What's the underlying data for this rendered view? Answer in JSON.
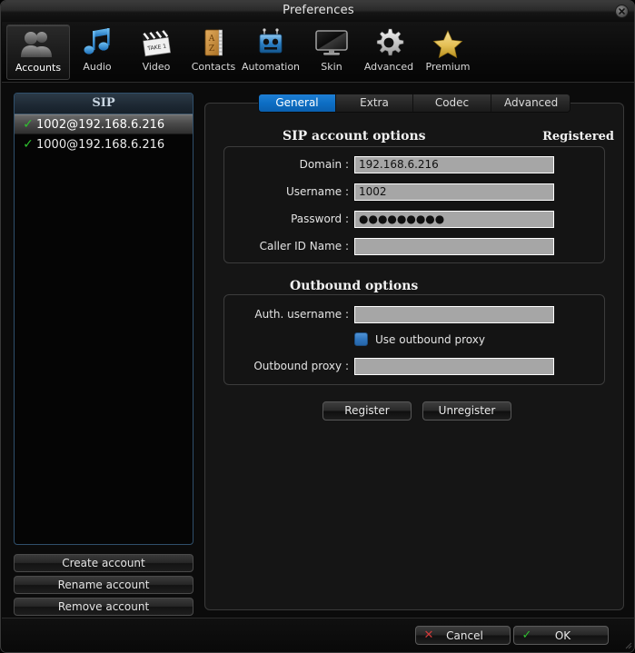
{
  "window": {
    "title": "Preferences",
    "close_icon": "close-icon"
  },
  "toolbar": {
    "items": [
      {
        "label": "Accounts",
        "icon": "users-icon",
        "selected": true
      },
      {
        "label": "Audio",
        "icon": "music-note-icon",
        "selected": false
      },
      {
        "label": "Video",
        "icon": "clapperboard-icon",
        "selected": false
      },
      {
        "label": "Contacts",
        "icon": "address-book-icon",
        "selected": false
      },
      {
        "label": "Automation",
        "icon": "robot-icon",
        "selected": false
      },
      {
        "label": "Skin",
        "icon": "monitor-icon",
        "selected": false
      },
      {
        "label": "Advanced",
        "icon": "gear-icon",
        "selected": false
      },
      {
        "label": "Premium",
        "icon": "star-icon",
        "selected": false
      }
    ]
  },
  "accounts_panel": {
    "header": "SIP",
    "rows": [
      {
        "check": "✓",
        "name": "1002@192.168.6.216",
        "selected": true
      },
      {
        "check": "✓",
        "name": "1000@192.168.6.216",
        "selected": false
      }
    ],
    "buttons": {
      "create": "Create account",
      "rename": "Rename account",
      "remove": "Remove account"
    }
  },
  "tabs": [
    {
      "label": "General",
      "active": true
    },
    {
      "label": "Extra",
      "active": false
    },
    {
      "label": "Codec",
      "active": false
    },
    {
      "label": "Advanced",
      "active": false
    }
  ],
  "sip_account_options": {
    "title": "SIP account options",
    "status": "Registered",
    "fields": [
      {
        "label": "Domain :",
        "value": "192.168.6.216",
        "placeholder": "",
        "type": "text"
      },
      {
        "label": "Username :",
        "value": "1002",
        "placeholder": "",
        "type": "text"
      },
      {
        "label": "Password :",
        "value": "●●●●●●●●●",
        "placeholder": "",
        "type": "text"
      },
      {
        "label": "Caller ID Name :",
        "value": "",
        "placeholder": "",
        "type": "text"
      }
    ]
  },
  "outbound_options": {
    "title": "Outbound options",
    "auth_label": "Auth. username :",
    "auth_value": "",
    "checkbox_label": "Use outbound proxy",
    "checkbox_checked": false,
    "proxy_label": "Outbound proxy :",
    "proxy_value": "",
    "register_button": "Register",
    "unregister_button": "Unregister"
  },
  "footer": {
    "cancel_label": "Cancel",
    "cancel_glyph": "✕",
    "ok_label": "OK",
    "ok_glyph": "✓"
  },
  "colors": {
    "accent_blue": "#0d6ec4",
    "check_green": "#2fbf2f",
    "cancel_red": "#d03a3a",
    "input_bg": "#a6a6a6",
    "panel_bg": "#151515",
    "window_bg": "#0b0b0b",
    "list_border": "#2f4f6b"
  }
}
